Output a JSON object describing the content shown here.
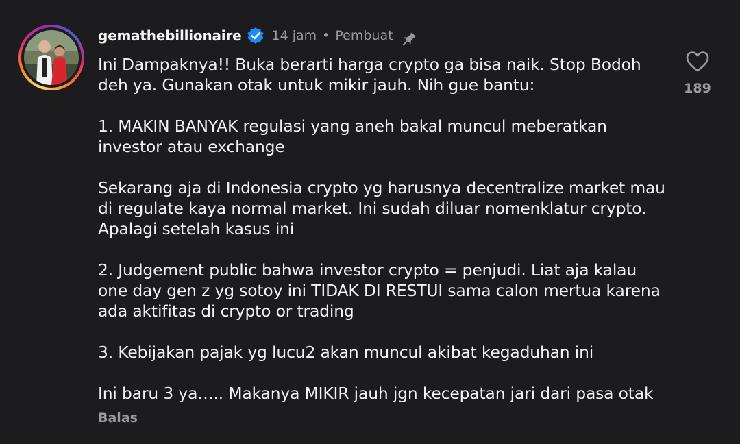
{
  "comment": {
    "username": "gemathebillionaire",
    "verified": true,
    "time_ago": "14 jam",
    "separator": "•",
    "creator_label": "Pembuat",
    "pinned_icon": "pin-icon",
    "lines": [
      "Ini Dampaknya!! Buka berarti harga crypto ga bisa naik. Stop Bodoh",
      "deh ya. Gunakan otak untuk mikir jauh. Nih gue bantu:",
      "",
      "1. MAKIN BANYAK regulasi yang aneh bakal muncul meberatkan",
      "investor atau exchange",
      "",
      "Sekarang aja di Indonesia crypto yg harusnya decentralize market mau",
      "di regulate kaya normal market. Ini sudah diluar nomenklatur crypto.",
      "Apalagi setelah kasus ini",
      "",
      "2. Judgement public bahwa investor crypto = penjudi. Liat aja kalau",
      "one day gen z yg sotoy ini TIDAK DI RESTUI sama calon mertua karena",
      "ada aktifitas di crypto or trading",
      "",
      "3. Kebijakan pajak yg lucu2 akan muncul akibat kegaduhan ini",
      "",
      "Ini baru 3 ya….. Makanya MIKIR jauh jgn kecepatan jari dari pasa otak"
    ],
    "reply_label": "Balas",
    "like_count": "189",
    "like_icon": "heart-icon"
  },
  "colors": {
    "background": "#1c1c1e",
    "text": "#f3f3f3",
    "muted": "#9a9a9f",
    "verified_badge": "#1d8cf8"
  }
}
